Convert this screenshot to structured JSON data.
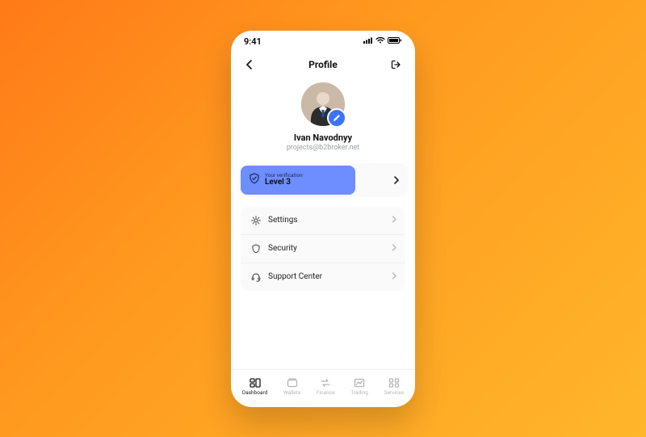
{
  "statusbar": {
    "time": "9:41"
  },
  "header": {
    "title": "Profile"
  },
  "profile": {
    "name": "Ivan Navodnyy",
    "email": "projects@b2broker.net"
  },
  "verification": {
    "caption": "Your verification",
    "level": "Level 3"
  },
  "menu": {
    "settings": "Settings",
    "security": "Security",
    "support": "Support Center"
  },
  "tabs": {
    "dashboard": "Dashboard",
    "wallets": "Wallets",
    "finance": "Finance",
    "trading": "Trading",
    "services": "Services"
  }
}
